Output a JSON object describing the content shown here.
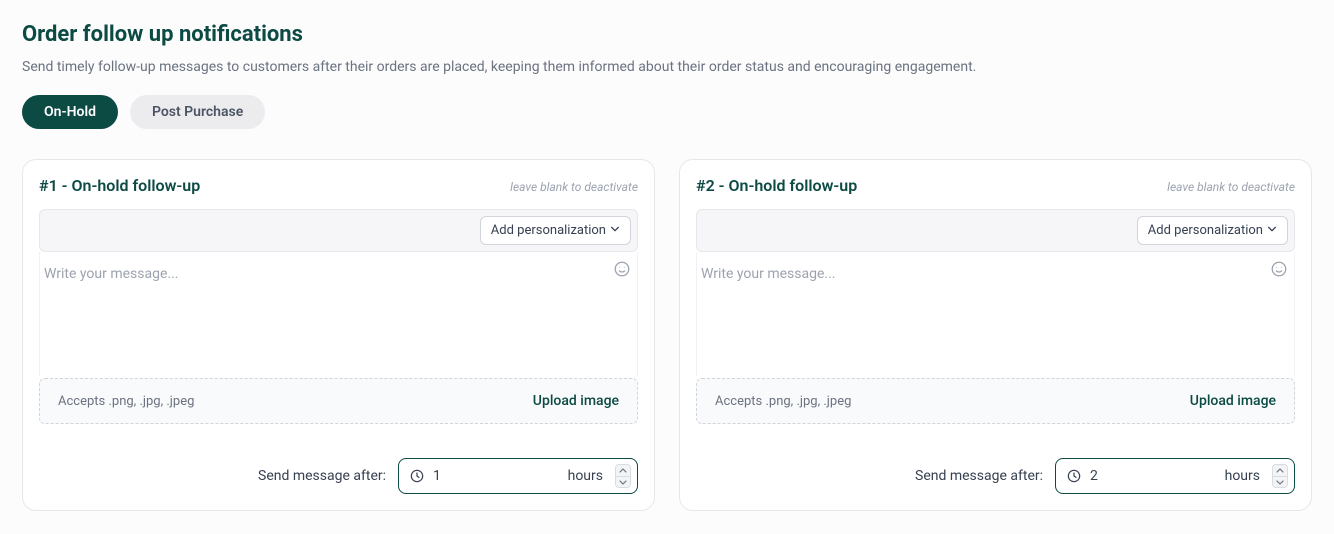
{
  "header": {
    "title": "Order follow up notifications",
    "description": "Send timely follow-up messages to customers after their orders are placed, keeping them informed about their order status and encouraging engagement."
  },
  "tabs": {
    "on_hold": "On-Hold",
    "post_purchase": "Post Purchase"
  },
  "common": {
    "deactivate_hint": "leave blank to deactivate",
    "add_personalization": "Add personalization",
    "message_placeholder": "Write your message...",
    "accepts": "Accepts .png, .jpg, .jpeg",
    "upload_image": "Upload image",
    "send_after_label": "Send message after:",
    "unit": "hours"
  },
  "cards": [
    {
      "title": "#1 - On-hold follow-up",
      "value": "1"
    },
    {
      "title": "#2 - On-hold follow-up",
      "value": "2"
    }
  ]
}
